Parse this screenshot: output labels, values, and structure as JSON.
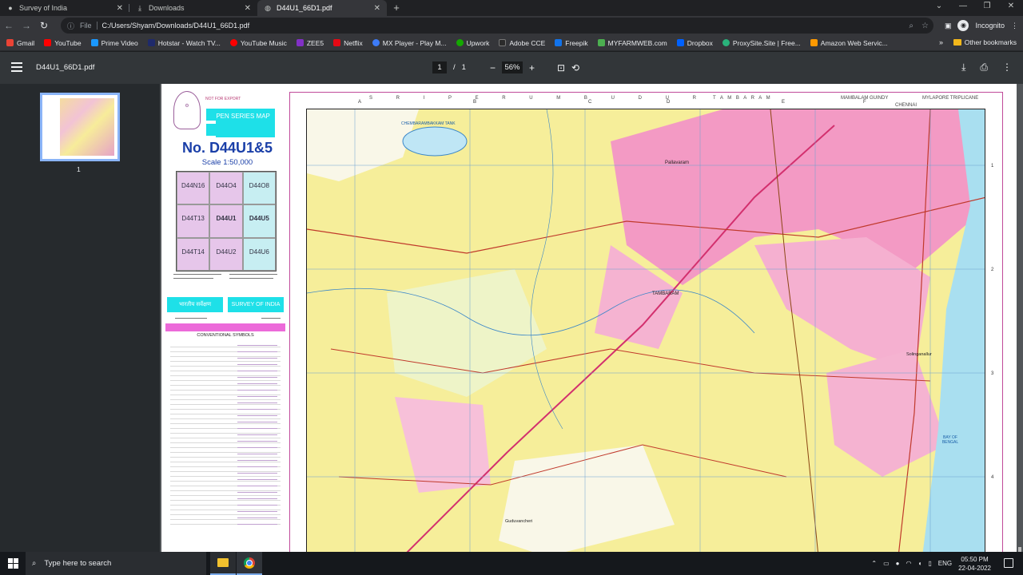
{
  "browser": {
    "tabs": [
      {
        "title": "Survey of India",
        "icon": "survey-of-india-favicon",
        "active": false
      },
      {
        "title": "Downloads",
        "icon": "download-icon",
        "active": false
      },
      {
        "title": "D44U1_66D1.pdf",
        "icon": "globe-icon",
        "active": true
      }
    ],
    "new_tab": "+",
    "omnibox": {
      "scheme": "File",
      "url": "C:/Users/Shyam/Downloads/D44U1_66D1.pdf"
    },
    "profile": "Incognito",
    "bookmarks": [
      {
        "label": "Gmail",
        "color": "#ea4335"
      },
      {
        "label": "YouTube",
        "color": "#ff0000"
      },
      {
        "label": "Prime Video",
        "color": "#1a98ff"
      },
      {
        "label": "Hotstar - Watch TV...",
        "color": "#1f2a6b"
      },
      {
        "label": "YouTube Music",
        "color": "#ff0000"
      },
      {
        "label": "ZEE5",
        "color": "#8230c6"
      },
      {
        "label": "Netflix",
        "color": "#e50914"
      },
      {
        "label": "MX Player - Play M...",
        "color": "#3d7bf7"
      },
      {
        "label": "Upwork",
        "color": "#14a800"
      },
      {
        "label": "Adobe CCE",
        "color": "#2b2b2b"
      },
      {
        "label": "Freepik",
        "color": "#1273eb"
      },
      {
        "label": "MYFARMWEB.com",
        "color": "#4caf50"
      },
      {
        "label": "Dropbox",
        "color": "#0061ff"
      },
      {
        "label": "ProxySite.Site | Free...",
        "color": "#2ab27b"
      },
      {
        "label": "Amazon Web Servic...",
        "color": "#ff9900"
      }
    ],
    "other_bookmarks": "Other bookmarks"
  },
  "pdf": {
    "title": "D44U1_66D1.pdf",
    "page_current": "1",
    "page_separator": "/",
    "page_total": "1",
    "zoom": "56%",
    "thumbnail_number": "1"
  },
  "map_sheet": {
    "not_for_export": "NOT FOR EXPORT",
    "open_series": "OPEN SERIES MAP",
    "map_no": "No.  D44U1&5",
    "scale": "Scale   1:50,000",
    "index_cells": [
      {
        "label": "D44N16",
        "style": "p"
      },
      {
        "label": "D44O4",
        "style": "p"
      },
      {
        "label": "D44O8",
        "style": "c"
      },
      {
        "label": "D44T13",
        "style": "p"
      },
      {
        "label": "D44U1",
        "style": "p"
      },
      {
        "label": "D44U5",
        "style": "c"
      },
      {
        "label": "D44T14",
        "style": "p"
      },
      {
        "label": "D44U2",
        "style": "p"
      },
      {
        "label": "D44U6",
        "style": "c"
      }
    ],
    "survey_label": "SURVEY OF INDIA",
    "conventional_symbols": "CONVENTIONAL SYMBOLS",
    "top_margin_names": "S R I P E R U M B U D U R",
    "tambaram_top": "T A M B A R A M",
    "mambalam": "MAMBALAM GUINDY",
    "chennai_top": "CHENNAI",
    "mylapore": "MYLAPORE TRIPLICANE",
    "grid_letters": [
      "A",
      "B",
      "C",
      "D",
      "E",
      "F"
    ],
    "grid_numbers": [
      "1",
      "2",
      "3",
      "4"
    ],
    "places": {
      "pallavaram": "Pallavaram",
      "tambaram": "TAMBARAM",
      "chemara": "CHEMBARAMBAKKAM TANK",
      "guduvanchery": "Guduvancheri",
      "sholinganallur": "Solinganallur",
      "bay_of_bengal": "BAY OF BENGAL"
    }
  },
  "taskbar": {
    "search_placeholder": "Type here to search",
    "lang": "ENG",
    "time": "05:50 PM",
    "date": "22-04-2022"
  }
}
